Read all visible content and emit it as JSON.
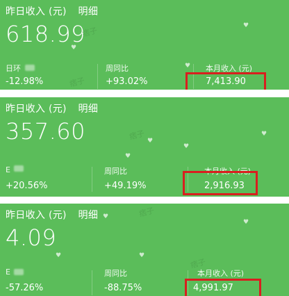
{
  "cards": [
    {
      "header_title": "昨日收入 (元)",
      "detail_link": "明细",
      "amount": "618.99",
      "stat1_label": "日环",
      "stat1_value": "-12.98%",
      "stat2_label": "周同比",
      "stat2_value": "+93.02%",
      "stat3_label": "本月收入 (元)",
      "stat3_value": "7,413.90",
      "watermark": "痞子"
    },
    {
      "header_title": "昨日收入 (元)",
      "detail_link": "明细",
      "amount": "357.60",
      "stat1_label": "E",
      "stat1_value": "+20.56%",
      "stat2_label": "周同比",
      "stat2_value": "+49.19%",
      "stat3_label": "本月收入 (元)",
      "stat3_value": "2,916.93",
      "watermark": "痞子"
    },
    {
      "header_title": "昨日收入 (元)",
      "detail_link": "明细",
      "amount": "4.09",
      "stat1_label": "E",
      "stat1_value": "-57.26%",
      "stat2_label": "周同比",
      "stat2_value": "-88.75%",
      "stat3_label": "本月收入 (元)",
      "stat3_value": "4,991.97",
      "watermark": "痞子"
    }
  ],
  "colors": {
    "card_bg": "#5bbd5a",
    "highlight_border": "#d91f1f",
    "text": "#ffffff"
  }
}
